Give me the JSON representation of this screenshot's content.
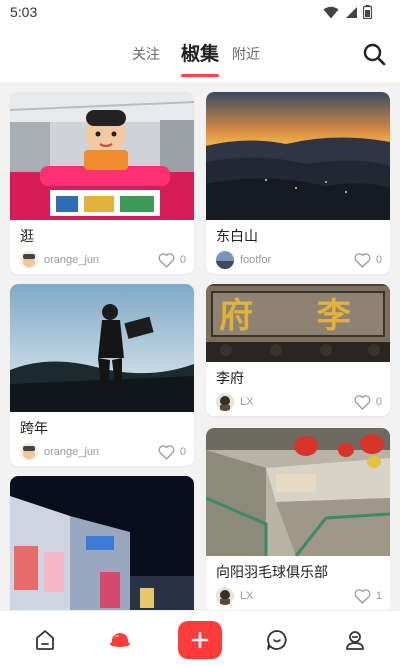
{
  "status_bar": {
    "time": "5:03",
    "icons": [
      "wifi-icon",
      "signal-icon",
      "battery-icon"
    ]
  },
  "tabs": [
    {
      "label": "关注",
      "active": false
    },
    {
      "label": "椒集",
      "active": true
    },
    {
      "label": "附近",
      "active": false
    }
  ],
  "colors": {
    "accent": "#ff4242",
    "fab": "#ff3b3b"
  },
  "feed": {
    "left": [
      {
        "title": "逛",
        "author": "orange_jun",
        "likes": "0",
        "liked": false
      },
      {
        "title": "跨年",
        "author": "orange_jun",
        "likes": "0",
        "liked": false
      },
      {
        "title": "",
        "author": "",
        "likes": ""
      }
    ],
    "right": [
      {
        "title": "东白山",
        "author": "footfor",
        "likes": "0",
        "liked": false
      },
      {
        "title": "李府",
        "author": "LX",
        "likes": "0",
        "liked": false
      },
      {
        "title": "向阳羽毛球俱乐部",
        "author": "LX",
        "likes": "1",
        "liked": false
      }
    ],
    "plaque_text": "府 李"
  },
  "bottom_nav": {
    "items": [
      "home-icon",
      "discover-icon",
      "add-icon",
      "message-icon",
      "profile-icon"
    ],
    "active": "discover-icon"
  }
}
